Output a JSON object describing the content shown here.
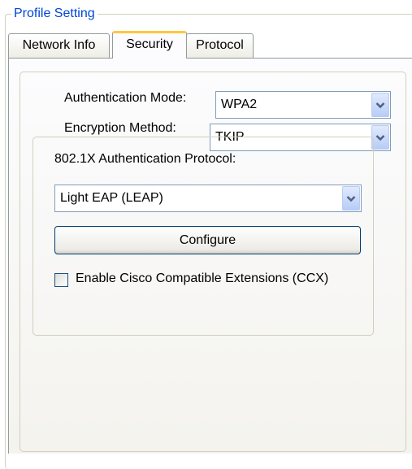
{
  "group": {
    "title": "Profile Setting"
  },
  "tabs": [
    {
      "label": "Network Info"
    },
    {
      "label": "Security"
    },
    {
      "label": "Protocol"
    }
  ],
  "security": {
    "auth_mode_label": "Authentication Mode:",
    "auth_mode_value": "WPA2",
    "encryption_label": "Encryption Method:",
    "encryption_value": "TKIP",
    "protocol_label": "802.1X Authentication Protocol:",
    "protocol_value": "Light EAP (LEAP)",
    "configure_label": "Configure",
    "ccx_label": "Enable Cisco Compatible Extensions (CCX)",
    "ccx_checked": false
  },
  "colors": {
    "accent": "#0046d5",
    "tab_highlight": "#ffc83c",
    "border": "#919b9c"
  },
  "icons": {
    "dropdown": "chevron-down-icon"
  }
}
